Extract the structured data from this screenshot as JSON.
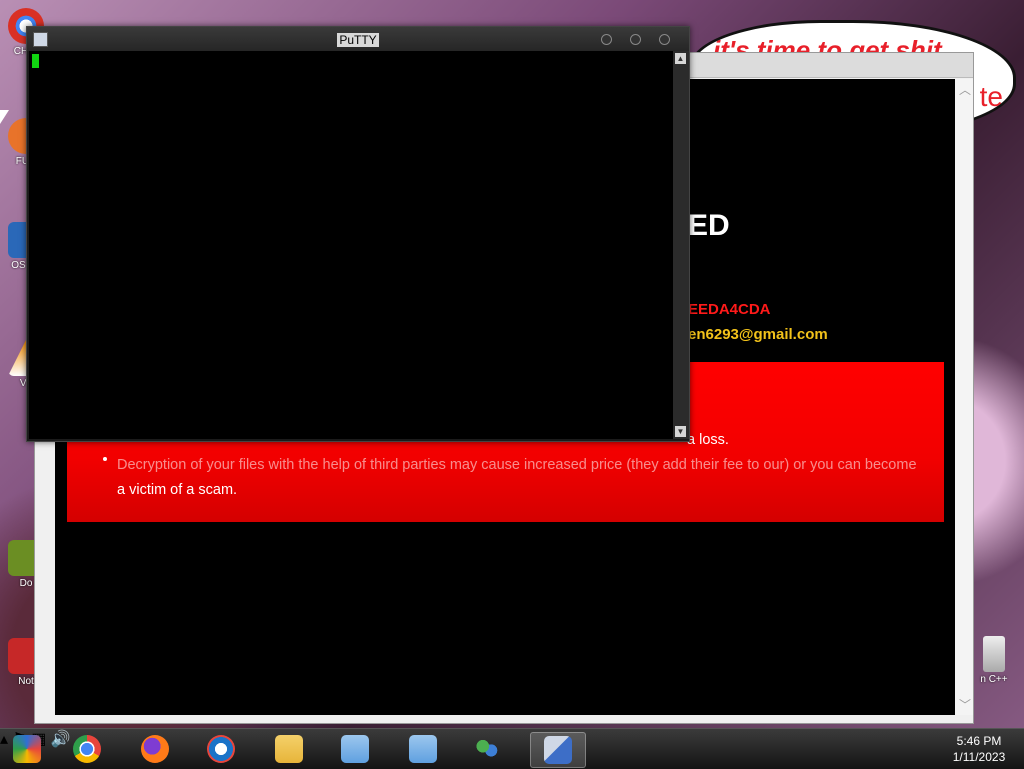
{
  "desktop": {
    "icons": [
      {
        "name": "chrome-shortcut",
        "label": "CH D",
        "color": "#d93025"
      },
      {
        "name": "furmark-shortcut",
        "label": "FUR",
        "color": "#e8732a"
      },
      {
        "name": "os-shortcut",
        "label": "OS LA",
        "color": "#2a68b8"
      },
      {
        "name": "vlc-shortcut",
        "label": "VL",
        "color": "#f28c00"
      },
      {
        "name": "doc-shortcut",
        "label": "Do",
        "color": "#6b8e23"
      },
      {
        "name": "notes-shortcut",
        "label": "Not",
        "color": "#c62828"
      }
    ],
    "right_label": "n C++",
    "bubble_text": "it's time to get shit",
    "bubble_text2": "te"
  },
  "ransom_window": {
    "heading": "ED",
    "id_text": "EEDA4CDA",
    "email": "en6293@gmail.com",
    "line_loss": "a loss.",
    "line_decrypt_1": "Decryption of your files with the help of third parties may cause increased price (they add their fee to our) or you can become",
    "line_decrypt_2": "a victim of a scam."
  },
  "putty": {
    "title": "PuTTY",
    "cursor_color": "#11d511"
  },
  "taskbar": {
    "items": [
      {
        "name": "taskbar-chrome-remote",
        "color": "#2f6fd6"
      },
      {
        "name": "taskbar-chrome",
        "color": "#e8453c"
      },
      {
        "name": "taskbar-firefox",
        "color": "#ff7a18"
      },
      {
        "name": "taskbar-opera",
        "color": "#1a73c8"
      },
      {
        "name": "taskbar-explorer",
        "color": "#e7b53a"
      },
      {
        "name": "taskbar-installer-1",
        "color": "#5fa0e0"
      },
      {
        "name": "taskbar-installer-2",
        "color": "#5fa0e0"
      },
      {
        "name": "taskbar-network",
        "color": "#4caf50"
      },
      {
        "name": "taskbar-putty",
        "color": "#3d6ec7"
      }
    ],
    "time": "5:46 PM",
    "date": "1/11/2023"
  }
}
